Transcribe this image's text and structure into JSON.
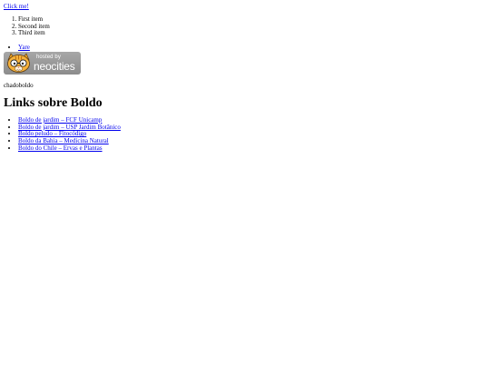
{
  "top_link": "Click me!",
  "numbered_list": [
    "First item",
    "Second item",
    "Third item"
  ],
  "nav_link": "Yare",
  "badge": {
    "alt": "hosted by neocities",
    "hosted_text": "hosted by",
    "brand_text": "neocities",
    "background_color": "#999999",
    "icon": "neocities-cat-icon"
  },
  "caption": "chadoboldo",
  "title": "Links sobre Boldo",
  "links": [
    "Boldo de jardim – FCF Unicamp",
    "Boldo de jardim – USP Jardim Botânico",
    "Boldo peludo – Fitocódigo",
    "Boldo da Bahia – Medicina Natural",
    "Boldo do Chile – Ervas e Plantas"
  ],
  "colors": {
    "link": "#0000ee",
    "text": "#000000",
    "background": "#ffffff"
  }
}
